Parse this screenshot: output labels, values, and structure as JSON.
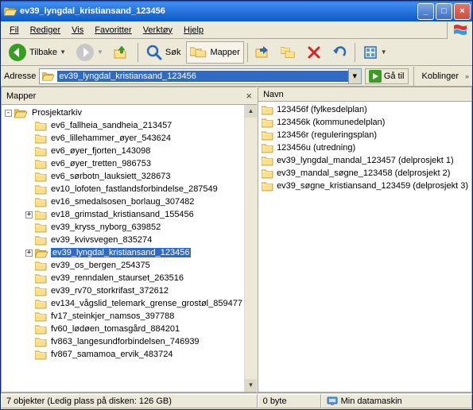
{
  "title": "ev39_lyngdal_kristiansand_123456",
  "menu": {
    "file": "Fil",
    "edit": "Rediger",
    "view": "Vis",
    "favorites": "Favoritter",
    "tools": "Verktøy",
    "help": "Hjelp"
  },
  "toolbar": {
    "back": "Tilbake",
    "search": "Søk",
    "folders": "Mapper"
  },
  "address": {
    "label": "Adresse",
    "value": "ev39_lyngdal_kristiansand_123456",
    "go": "Gå til",
    "links": "Koblinger"
  },
  "leftpane": {
    "title": "Mapper"
  },
  "rightpane": {
    "col_name": "Navn"
  },
  "tree": {
    "root": "Prosjektarkiv",
    "items": [
      {
        "name": "ev6_fallheia_sandheia_213457",
        "exp": ""
      },
      {
        "name": "ev6_lillehammer_øyer_543624",
        "exp": ""
      },
      {
        "name": "ev6_øyer_fjorten_143098",
        "exp": ""
      },
      {
        "name": "ev6_øyer_tretten_986753",
        "exp": ""
      },
      {
        "name": "ev6_sørbotn_lauksiett_328673",
        "exp": ""
      },
      {
        "name": "ev10_lofoten_fastlandsforbindelse_287549",
        "exp": ""
      },
      {
        "name": "ev16_smedalsosen_borlaug_307482",
        "exp": ""
      },
      {
        "name": "ev18_grimstad_kristiansand_155456",
        "exp": "+"
      },
      {
        "name": "ev39_kryss_nyborg_639852",
        "exp": ""
      },
      {
        "name": "ev39_kvivsvegen_835274",
        "exp": ""
      },
      {
        "name": "ev39_lyngdal_kristiansand_123456",
        "exp": "+",
        "selected": true,
        "open": true
      },
      {
        "name": "ev39_os_bergen_254375",
        "exp": ""
      },
      {
        "name": "ev39_renndalen_staurset_263516",
        "exp": ""
      },
      {
        "name": "ev39_rv70_storkrifast_372612",
        "exp": ""
      },
      {
        "name": "ev134_vågslid_telemark_grense_grostøl_859477",
        "exp": ""
      },
      {
        "name": "fv17_steinkjer_namsos_397788",
        "exp": ""
      },
      {
        "name": "fv60_lødøen_tomasgård_884201",
        "exp": ""
      },
      {
        "name": "fv863_langesundforbindelsen_746939",
        "exp": ""
      },
      {
        "name": "fv867_samamoa_ervik_483724",
        "exp": ""
      }
    ]
  },
  "contents": [
    {
      "name": "123456f (fylkesdelplan)"
    },
    {
      "name": "123456k (kommunedelplan)"
    },
    {
      "name": "123456r (reguleringsplan)"
    },
    {
      "name": "123456u (utredning)"
    },
    {
      "name": "ev39_lyngdal_mandal_123457 (delprosjekt 1)"
    },
    {
      "name": "ev39_mandal_søgne_123458 (delprosjekt 2)"
    },
    {
      "name": "ev39_søgne_kristiansand_123459 (delprosjekt 3)"
    }
  ],
  "status": {
    "left": "7 objekter (Ledig plass på disken: 126 GB)",
    "mid": "0 byte",
    "right": "Min datamaskin"
  }
}
